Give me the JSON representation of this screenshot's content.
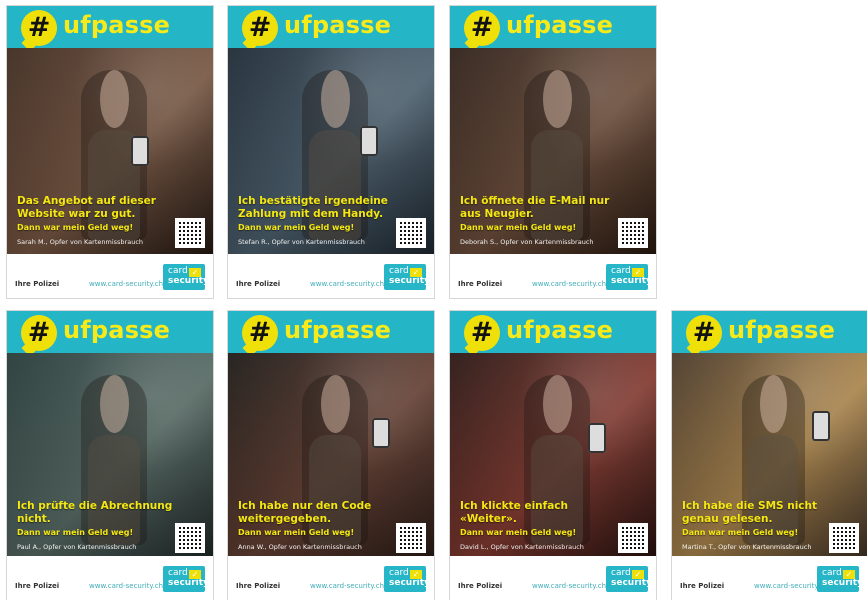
{
  "posters": [
    {
      "brand": "ufpasse",
      "headline": "Das Angebot auf dieser Website war zu gut.",
      "subline": "Dann war mein Geld weg!",
      "credit": "Sarah M., Opfer von Kartenmissbrauch",
      "footer_left": "Ihre Polizei",
      "footer_url": "www.card-security.ch",
      "logo_top": "card",
      "logo_bottom": "security",
      "bg": "#6d4f3f"
    },
    {
      "brand": "ufpasse",
      "headline": "Ich bestätigte irgendeine Zahlung mit dem Handy.",
      "subline": "Dann war mein Geld weg!",
      "credit": "Stefan R., Opfer von Kartenmissbrauch",
      "footer_left": "Ihre Polizei",
      "footer_url": "www.card-security.ch",
      "logo_top": "card",
      "logo_bottom": "security",
      "bg": "#405568"
    },
    {
      "brand": "ufpasse",
      "headline": "Ich öffnete die E-Mail nur aus Neugier.",
      "subline": "Dann war mein Geld weg!",
      "credit": "Deborah S., Opfer von Kartenmissbrauch",
      "footer_left": "Ihre Polizei",
      "footer_url": "www.card-security.ch",
      "logo_top": "card",
      "logo_bottom": "security",
      "bg": "#5e4033"
    },
    {
      "brand": "ufpasse",
      "headline": "Ich prüfte die Abrechnung nicht.",
      "subline": "Dann war mein Geld weg!",
      "credit": "Paul A., Opfer von Kartenmissbrauch",
      "footer_left": "Ihre Polizei",
      "footer_url": "www.card-security.ch",
      "logo_top": "card",
      "logo_bottom": "security",
      "bg": "#4b5a55"
    },
    {
      "brand": "ufpasse",
      "headline": "Ich habe nur den Code weitergegeben.",
      "subline": "Dann war mein Geld weg!",
      "credit": "Anna W., Opfer von Kartenmissbrauch",
      "footer_left": "Ihre Polizei",
      "footer_url": "www.card-security.ch",
      "logo_top": "card",
      "logo_bottom": "security",
      "bg": "#6a4333"
    },
    {
      "brand": "ufpasse",
      "headline": "Ich klickte einfach «Weiter».",
      "subline": "Dann war mein Geld weg!",
      "credit": "David L., Opfer von Kartenmissbrauch",
      "footer_left": "Ihre Polizei",
      "footer_url": "www.card-security.ch",
      "logo_top": "card",
      "logo_bottom": "security",
      "bg": "#6a332c"
    },
    {
      "brand": "ufpasse",
      "headline": "Ich habe die SMS nicht genau gelesen.",
      "subline": "Dann war mein Geld weg!",
      "credit": "Martina T., Opfer von Kartenmissbrauch",
      "footer_left": "Ihre Polizei",
      "footer_url": "www.card-security.ch",
      "logo_top": "card",
      "logo_bottom": "security",
      "bg": "#8a6a3d"
    }
  ]
}
